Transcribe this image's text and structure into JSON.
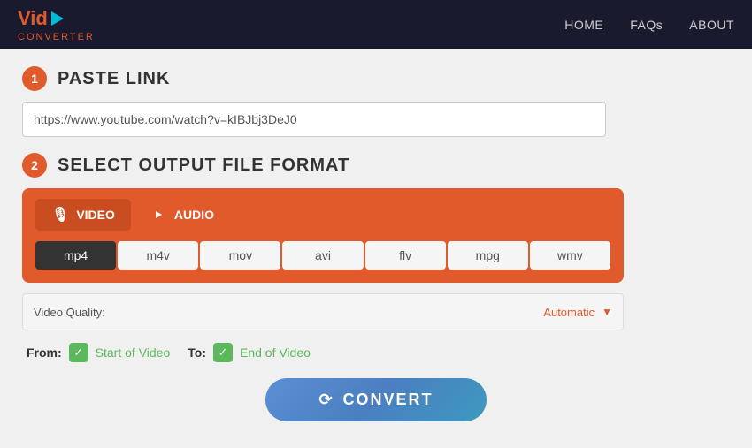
{
  "header": {
    "logo_vid": "Vid",
    "logo_subtitle": "CONVERTER",
    "nav": {
      "home": "HOME",
      "faqs": "FAQs",
      "about": "ABOUT"
    }
  },
  "step1": {
    "badge": "1",
    "title": "PASTE LINK",
    "input_placeholder": "https://www.youtube.com/watch?v=kIBJbj3DeJ0",
    "input_value": "https://www.youtube.com/watch?v=kIBJbj3DeJ0"
  },
  "step2": {
    "badge": "2",
    "title": "SELECT OUTPUT FILE FORMAT",
    "tabs": [
      {
        "id": "video",
        "label": "VIDEO",
        "active": true
      },
      {
        "id": "audio",
        "label": "AUDIO",
        "active": false
      }
    ],
    "formats": [
      {
        "id": "mp4",
        "label": "mp4",
        "selected": true
      },
      {
        "id": "m4v",
        "label": "m4v",
        "selected": false
      },
      {
        "id": "mov",
        "label": "mov",
        "selected": false
      },
      {
        "id": "avi",
        "label": "avi",
        "selected": false
      },
      {
        "id": "flv",
        "label": "flv",
        "selected": false
      },
      {
        "id": "mpg",
        "label": "mpg",
        "selected": false
      },
      {
        "id": "wmv",
        "label": "wmv",
        "selected": false
      }
    ],
    "quality_label": "Video Quality:",
    "quality_value": "Automatic"
  },
  "trim": {
    "from_label": "From:",
    "to_label": "To:",
    "start_label": "Start of Video",
    "end_label": "End of Video"
  },
  "convert": {
    "button_label": "CONVERT"
  }
}
